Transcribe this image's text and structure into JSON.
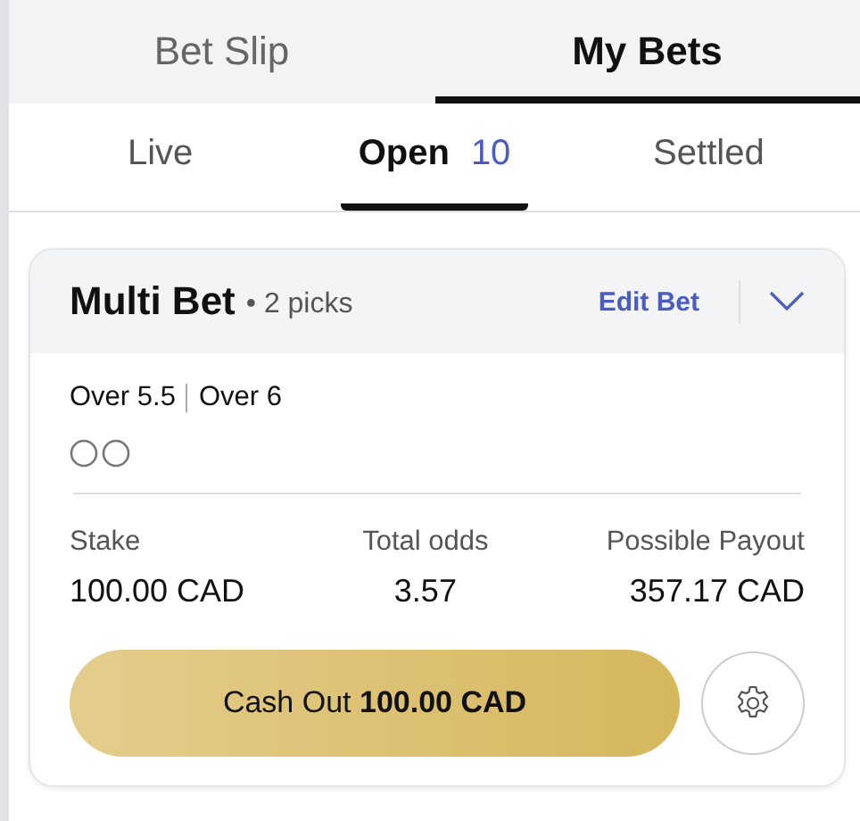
{
  "main_tabs": [
    {
      "label": "Bet Slip",
      "selected": false
    },
    {
      "label": "My Bets",
      "selected": true
    }
  ],
  "sub_tabs": [
    {
      "label": "Live",
      "selected": false
    },
    {
      "label": "Open",
      "count": "10",
      "selected": true
    },
    {
      "label": "Settled",
      "selected": false
    }
  ],
  "bet": {
    "title": "Multi Bet",
    "subtitle": "• 2 picks",
    "edit_label": "Edit Bet",
    "expanded": false,
    "selections": [
      "Over 5.5",
      "Over 6"
    ],
    "legs": [
      {
        "settled": false
      },
      {
        "settled": false
      }
    ],
    "stats": [
      {
        "label": "Stake",
        "value": "100.00 CAD"
      },
      {
        "label": "Total odds",
        "value": "3.57"
      },
      {
        "label": "Possible Payout",
        "value": "357.17 CAD"
      }
    ],
    "cash_out": "Cash Out **100.00 CAD**"
  }
}
